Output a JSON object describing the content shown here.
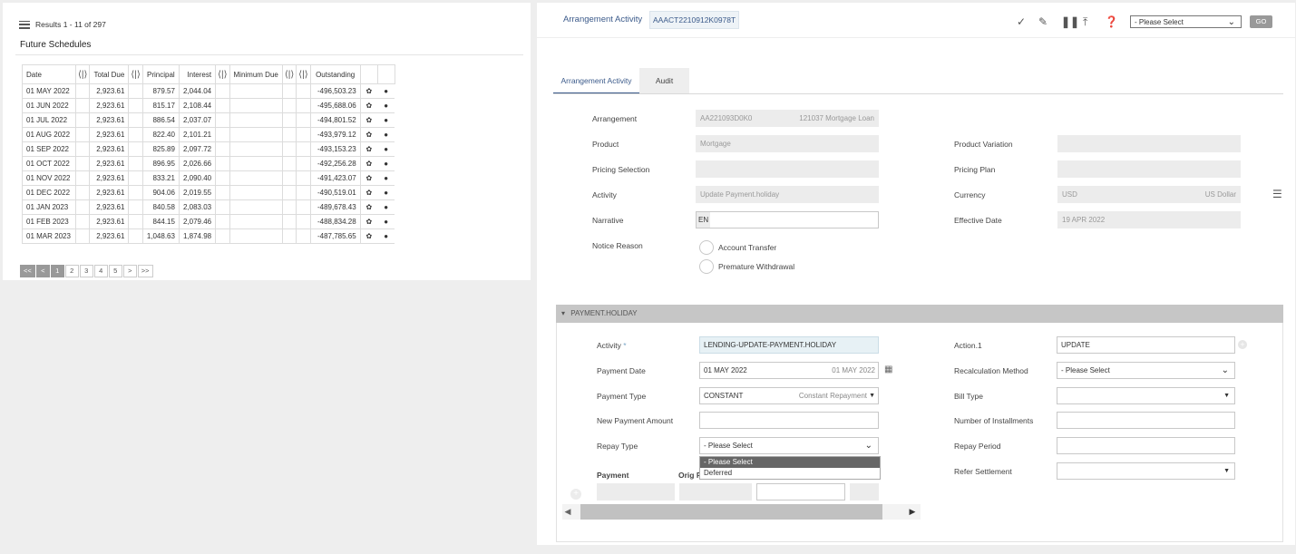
{
  "left": {
    "results": "Results 1 - 11 of 297",
    "title": "Future Schedules",
    "columns": [
      "Date",
      "Total Due",
      "Principal",
      "Interest",
      "Minimum Due",
      "Outstanding"
    ],
    "rows": [
      [
        "01 MAY 2022",
        "2,923.61",
        "879.57",
        "2,044.04",
        "-496,503.23"
      ],
      [
        "01 JUN 2022",
        "2,923.61",
        "815.17",
        "2,108.44",
        "-495,688.06"
      ],
      [
        "01 JUL 2022",
        "2,923.61",
        "886.54",
        "2,037.07",
        "-494,801.52"
      ],
      [
        "01 AUG 2022",
        "2,923.61",
        "822.40",
        "2,101.21",
        "-493,979.12"
      ],
      [
        "01 SEP 2022",
        "2,923.61",
        "825.89",
        "2,097.72",
        "-493,153.23"
      ],
      [
        "01 OCT 2022",
        "2,923.61",
        "896.95",
        "2,026.66",
        "-492,256.28"
      ],
      [
        "01 NOV 2022",
        "2,923.61",
        "833.21",
        "2,090.40",
        "-491,423.07"
      ],
      [
        "01 DEC 2022",
        "2,923.61",
        "904.06",
        "2,019.55",
        "-490,519.01"
      ],
      [
        "01 JAN 2023",
        "2,923.61",
        "840.58",
        "2,083.03",
        "-489,678.43"
      ],
      [
        "01 FEB 2023",
        "2,923.61",
        "844.15",
        "2,079.46",
        "-488,834.28"
      ],
      [
        "01 MAR 2023",
        "2,923.61",
        "1,048.63",
        "1,874.98",
        "-487,785.65"
      ]
    ],
    "pager": [
      "<<",
      "<",
      "1",
      "2",
      "3",
      "4",
      "5",
      ">",
      ">>"
    ]
  },
  "right": {
    "title": "Arrangement Activity",
    "id": "AAACT2210912K0978T",
    "select_placeholder": "- Please Select",
    "go": "GO",
    "tabs": [
      "Arrangement Activity",
      "Audit"
    ],
    "arrangement_label": "Arrangement",
    "arrangement_id": "AA221093D0K0",
    "arrangement_desc": "121037 Mortgage Loan",
    "product_label": "Product",
    "product_value": "Mortgage",
    "product_variation_label": "Product Variation",
    "pricing_selection_label": "Pricing Selection",
    "pricing_plan_label": "Pricing Plan",
    "activity_label": "Activity",
    "activity_value": "Update Payment.holiday",
    "currency_label": "Currency",
    "currency_code": "USD",
    "currency_name": "US Dollar",
    "narrative_label": "Narrative",
    "narrative_lang": "EN",
    "effective_date_label": "Effective Date",
    "effective_date": "19 APR 2022",
    "notice_reason_label": "Notice Reason",
    "notice_options": [
      "Account Transfer",
      "Premature Withdrawal"
    ],
    "section_title": "PAYMENT.HOLIDAY",
    "ph_activity_label": "Activity",
    "ph_activity_value": "LENDING-UPDATE-PAYMENT.HOLIDAY",
    "action_label": "Action.1",
    "action_value": "UPDATE",
    "payment_date_label": "Payment Date",
    "payment_date_value": "01 MAY 2022",
    "payment_date_echo": "01 MAY 2022",
    "recalc_label": "Recalculation Method",
    "recalc_value": "- Please Select",
    "payment_type_label": "Payment Type",
    "payment_type_code": "CONSTANT",
    "payment_type_name": "Constant Repayment",
    "bill_type_label": "Bill Type",
    "new_payment_label": "New Payment Amount",
    "installments_label": "Number of Installments",
    "repay_type_label": "Repay Type",
    "repay_type_value": "- Please Select",
    "repay_period_label": "Repay Period",
    "refer_settlement_label": "Refer Settlement",
    "payment_col": "Payment",
    "orig_col": "Orig P",
    "dropdown_options": [
      "- Please Select",
      "Deferred"
    ]
  }
}
